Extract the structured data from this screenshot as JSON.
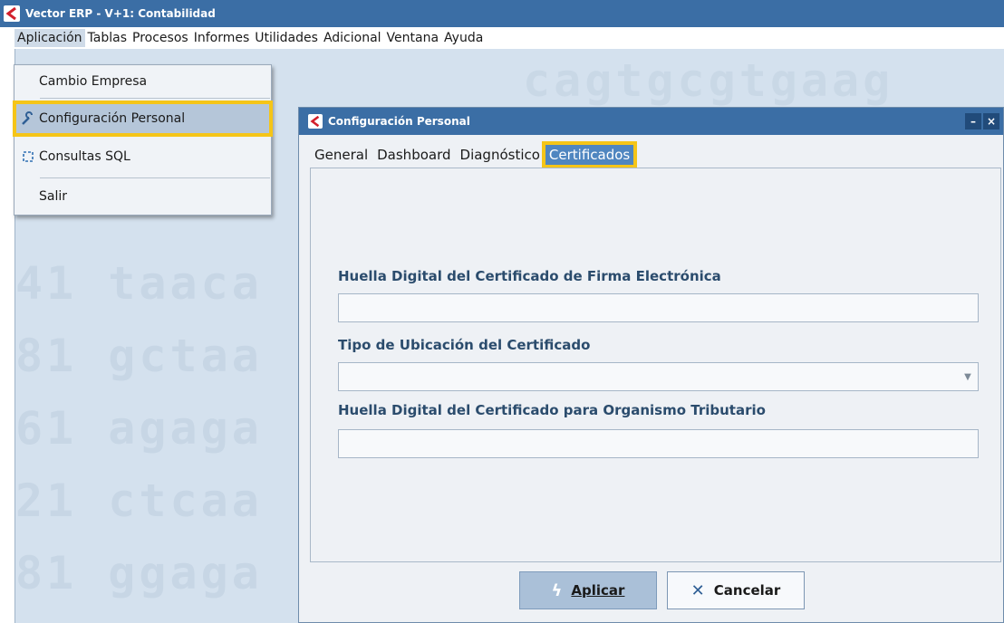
{
  "app": {
    "title": "Vector ERP - V+1: Contabilidad"
  },
  "menubar": {
    "items": [
      "Aplicación",
      "Tablas",
      "Procesos",
      "Informes",
      "Utilidades",
      "Adicional",
      "Ventana",
      "Ayuda"
    ]
  },
  "dropdown": {
    "items": [
      {
        "label": "Cambio Empresa",
        "icon": ""
      },
      {
        "label": "Configuración Personal",
        "icon": "wrench-icon"
      },
      {
        "label": "Consultas SQL",
        "icon": "sql-icon"
      },
      {
        "label": "Salir",
        "icon": ""
      }
    ]
  },
  "background": {
    "lines": [
      "",
      "41  taaca",
      "81  gctaa",
      "61  agaga",
      "21  ctcaa",
      "81  ggaga"
    ],
    "top_faded": "cagtgcgtgaag"
  },
  "dialog": {
    "title": "Configuración Personal",
    "minimize_label": "–",
    "close_label": "×",
    "tabs": [
      "General",
      "Dashboard",
      "Diagnóstico",
      "Certificados"
    ],
    "active_tab": "Certificados",
    "fields": {
      "firma_label": "Huella Digital del Certificado de Firma Electrónica",
      "firma_value": "",
      "ubicacion_label": "Tipo de Ubicación del Certificado",
      "ubicacion_value": "",
      "tributario_label": "Huella Digital del Certificado para Organismo Tributario",
      "tributario_value": ""
    },
    "buttons": {
      "apply": "Aplicar",
      "cancel": "Cancelar"
    }
  },
  "colors": {
    "titlebar": "#3b6ea5",
    "workspace": "#d4e1ee",
    "highlight_outline": "#f5c518",
    "active_tab": "#4f86c0"
  }
}
